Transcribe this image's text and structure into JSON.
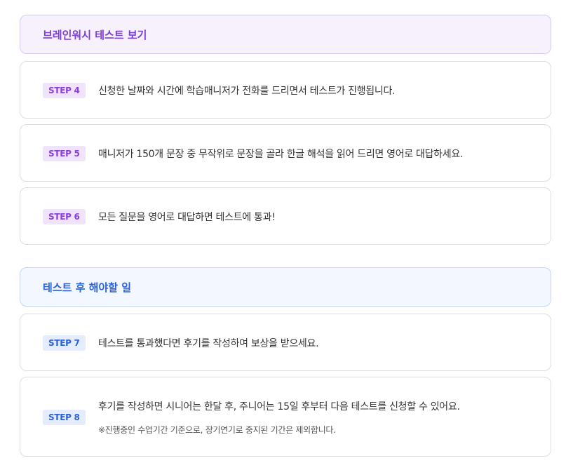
{
  "sections": [
    {
      "title": "브레인워시 테스트 보기",
      "color": "#7a3fd6"
    },
    {
      "title": "테스트 후 해야할 일",
      "color": "#2d62d8"
    }
  ],
  "steps": [
    {
      "label": "STEP 4",
      "text": "신청한 날짜와 시간에 학습매니저가 전화를 드리면서 테스트가 진행됩니다."
    },
    {
      "label": "STEP 5",
      "text": "매니저가 150개 문장 중 무작위로 문장을 골라 한글 해석을 읽어 드리면 영어로 대답하세요."
    },
    {
      "label": "STEP 6",
      "text": "모든 질문을 영어로 대답하면 테스트에 통과!"
    },
    {
      "label": "STEP 7",
      "text": "테스트를 통과했다면 후기를 작성하여 보상을 받으세요."
    },
    {
      "label": "STEP 8",
      "text": "후기를 작성하면 시니어는 한달 후, 주니어는 15일 후부터 다음 테스트를 신청할 수 있어요.",
      "note": "※진행중인 수업기간 기준으로, 장기연기로 중지된 기간은 제외합니다."
    }
  ]
}
